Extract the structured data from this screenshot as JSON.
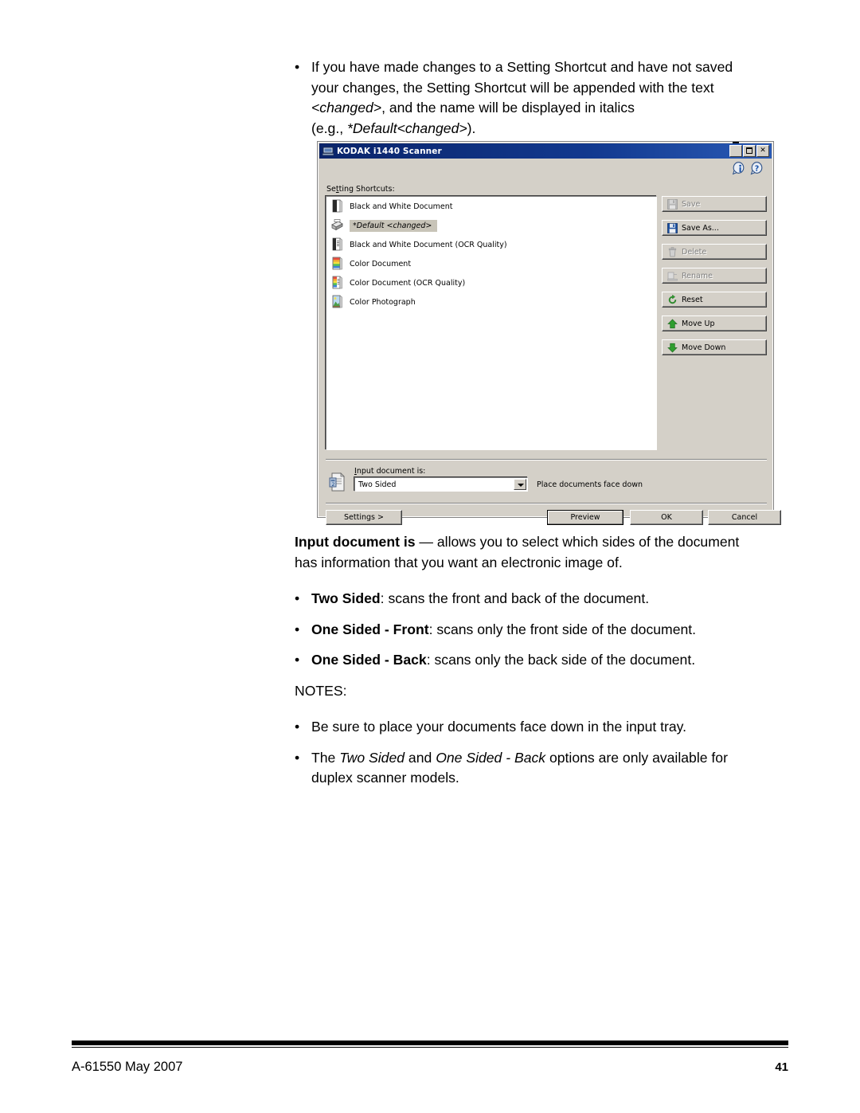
{
  "page": {
    "intro_bullet": {
      "marker": "•",
      "line1": "If you have made changes to a Setting Shortcut and have not saved",
      "line2": "your changes, the Setting Shortcut will be appended with the text",
      "line3_italic": "<changed>",
      "line3_rest": ", and the name will be displayed in italics",
      "line4_pre": "(e.g., ",
      "line4_italic": "*Default<changed>",
      "line4_post": ")."
    },
    "section": {
      "lead_bold": "Input document is",
      "lead_rest": " — allows you to select which sides of the document",
      "lead_line2": "has information that you want an electronic image of.",
      "bullets": [
        {
          "marker": "•",
          "bold": "Two Sided",
          "rest": ": scans the front and back of the document."
        },
        {
          "marker": "•",
          "bold": "One Sided - Front",
          "rest": ": scans only the front side of the document."
        },
        {
          "marker": "•",
          "bold": "One Sided - Back",
          "rest": ": scans only the back side of the document."
        }
      ]
    },
    "notes": {
      "heading": "NOTES:",
      "items": [
        {
          "marker": "•",
          "text": "Be sure to place your documents face down in the input tray."
        }
      ],
      "last": {
        "marker": "•",
        "pre": "The ",
        "it1": "Two Sided",
        "mid": " and ",
        "it2": "One Sided - Back",
        "post": " options are only available for",
        "line2": "duplex scanner models."
      }
    },
    "footer": {
      "left": "A-61550  May 2007",
      "right": "41"
    }
  },
  "dialog": {
    "title": "KODAK i1440 Scanner",
    "title_icon": "scanner-icon",
    "window_buttons": [
      {
        "name": "minimize",
        "glyph": ""
      },
      {
        "name": "maximize",
        "glyph": ""
      },
      {
        "name": "close",
        "glyph": "✕"
      }
    ],
    "header_icons": [
      {
        "name": "info-icon",
        "glyph": "i"
      },
      {
        "name": "help-icon",
        "glyph": "?"
      }
    ],
    "shortcuts_label_pre": "Se",
    "shortcuts_label_accel": "t",
    "shortcuts_label_post": "ting Shortcuts:",
    "shortcut_items": [
      {
        "label": "Black and White Document",
        "icon": "bw-document-icon",
        "selected": false
      },
      {
        "label": "*Default <changed>",
        "icon": "scanner-default-icon",
        "selected": true
      },
      {
        "label": "Black and White Document (OCR Quality)",
        "icon": "bw-ocr-document-icon",
        "selected": false
      },
      {
        "label": "Color Document",
        "icon": "color-document-icon",
        "selected": false
      },
      {
        "label": "Color Document (OCR Quality)",
        "icon": "color-ocr-document-icon",
        "selected": false
      },
      {
        "label": "Color Photograph",
        "icon": "color-photograph-icon",
        "selected": false
      }
    ],
    "side_buttons": [
      {
        "label": "Save",
        "icon": "save-icon",
        "disabled": true
      },
      {
        "label": "Save As...",
        "icon": "save-as-icon",
        "disabled": false
      },
      {
        "label": "Delete",
        "icon": "delete-icon",
        "disabled": true
      },
      {
        "label": "Rename",
        "icon": "rename-icon",
        "disabled": true
      },
      {
        "label": "Reset",
        "icon": "reset-icon",
        "disabled": false
      },
      {
        "label": "Move Up",
        "icon": "arrow-up-icon",
        "disabled": false
      },
      {
        "label": "Move Down",
        "icon": "arrow-down-icon",
        "disabled": false
      }
    ],
    "input_document": {
      "label_pre": "",
      "label_accel": "I",
      "label_post": "nput document is:",
      "value": "Two Sided",
      "options": [
        "Two Sided",
        "One Sided - Front",
        "One Sided - Back"
      ],
      "note": "Place documents face down",
      "icon": "input-document-icon"
    },
    "footer_buttons": [
      {
        "label": "Settings >",
        "name": "settings-button",
        "default": false
      },
      {
        "label": "Preview",
        "name": "preview-button",
        "default": true
      },
      {
        "label": "OK",
        "name": "ok-button",
        "default": false
      },
      {
        "label": "Cancel",
        "name": "cancel-button",
        "default": false
      }
    ]
  },
  "colors": {
    "title_bar": "#0a246a",
    "dialog_face": "#d4d0c8",
    "selection": "#c8c4b8",
    "accent_green": "#2f9e2f",
    "accent_blue": "#1e5fbe"
  }
}
